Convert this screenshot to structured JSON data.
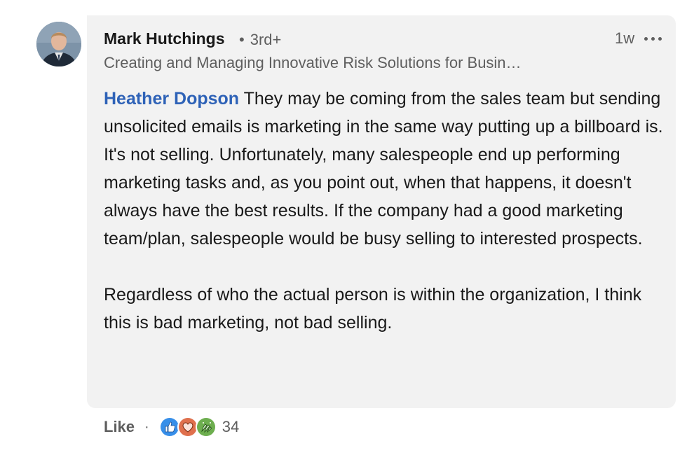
{
  "author": {
    "name": "Mark Hutchings",
    "degree": "3rd+",
    "headline": "Creating and Managing Innovative Risk Solutions for Busin…",
    "avatar": "profile-photo"
  },
  "comment": {
    "time": "1w",
    "mention": "Heather Dopson",
    "paragraph1": " They may be coming from the sales team but sending unsolicited emails is marketing in the same way putting up a billboard is. It's not selling. Unfortunately, many salespeople end up performing marketing tasks and, as you point out, when that happens, it doesn't always have the best results. If the company had a good marketing team/plan, salespeople would be busy selling to interested prospects.",
    "paragraph2": "Regardless of who the actual person is within the organization, I think this is bad marketing, not bad selling."
  },
  "actions": {
    "like_label": "Like",
    "separator": "·",
    "reaction_icons": [
      "like-icon",
      "love-icon",
      "celebrate-icon"
    ],
    "reaction_count": "34"
  },
  "colors": {
    "bubble": "#f2f2f2",
    "mention": "#2e62b7",
    "secondary_text": "#5e5e5e",
    "like": "#378fe9",
    "love": "#df704d",
    "celebrate": "#6dae4f"
  }
}
